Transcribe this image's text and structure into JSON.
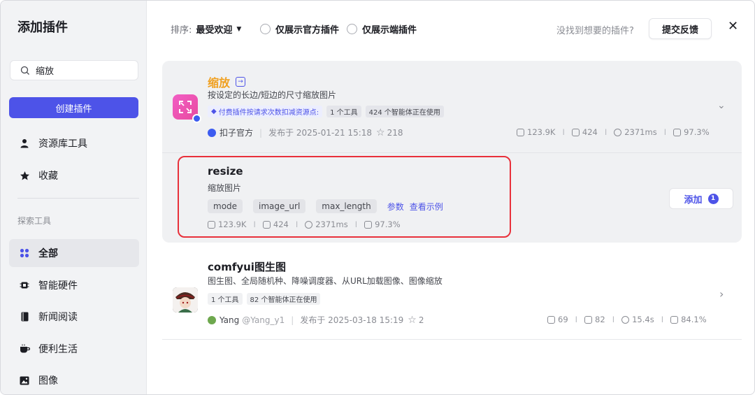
{
  "sidebar": {
    "title": "添加插件",
    "search_value": "缩放",
    "create_label": "创建插件",
    "top_items": [
      {
        "label": "资源库工具",
        "icon": "user-icon"
      },
      {
        "label": "收藏",
        "icon": "star-icon"
      }
    ],
    "section_label": "探索工具",
    "categories": [
      {
        "label": "全部",
        "icon": "grid-icon",
        "active": true
      },
      {
        "label": "智能硬件",
        "icon": "chip-icon"
      },
      {
        "label": "新闻阅读",
        "icon": "book-icon"
      },
      {
        "label": "便利生活",
        "icon": "cup-icon"
      },
      {
        "label": "图像",
        "icon": "image-icon"
      }
    ]
  },
  "topbar": {
    "sort_label": "排序:",
    "sort_value": "最受欢迎",
    "filter_official": "仅展示官方插件",
    "filter_client": "仅展示端插件",
    "not_found": "没找到想要的插件?",
    "feedback": "提交反馈"
  },
  "plugin1": {
    "name": "缩放",
    "desc": "按设定的长边/短边的尺寸缩放图片",
    "paid_tag": "付费插件按请求次数扣减资源点:",
    "tool_count": "1 个工具",
    "agents": "424 个智能体正在使用",
    "author": "扣子官方",
    "published": "发布于 2025-01-21 15:18",
    "stars": "218",
    "stats": [
      "123.9K",
      "424",
      "2371ms",
      "97.3%"
    ]
  },
  "tool": {
    "name": "resize",
    "desc": "缩放图片",
    "params": [
      "mode",
      "image_url",
      "max_length"
    ],
    "params_link": "参数",
    "example_link": "查看示例",
    "stats": [
      "123.9K",
      "424",
      "2371ms",
      "97.3%"
    ],
    "add_label": "添加",
    "add_count": "1"
  },
  "plugin2": {
    "name": "comfyui图生图",
    "desc": "图生图、全局随机种、降噪调度器、从URL加载图像、图像缩放",
    "tool_count": "1 个工具",
    "agents": "82 个智能体正在使用",
    "author": "Yang",
    "handle": "@Yang_y1",
    "published": "发布于 2025-03-18 15:19",
    "stars": "2",
    "stats": [
      "69",
      "82",
      "15.4s",
      "84.1%"
    ]
  },
  "colors": {
    "accent": "#4d53e8",
    "highlight": "#e8303a",
    "title_orange": "#f0a020"
  }
}
